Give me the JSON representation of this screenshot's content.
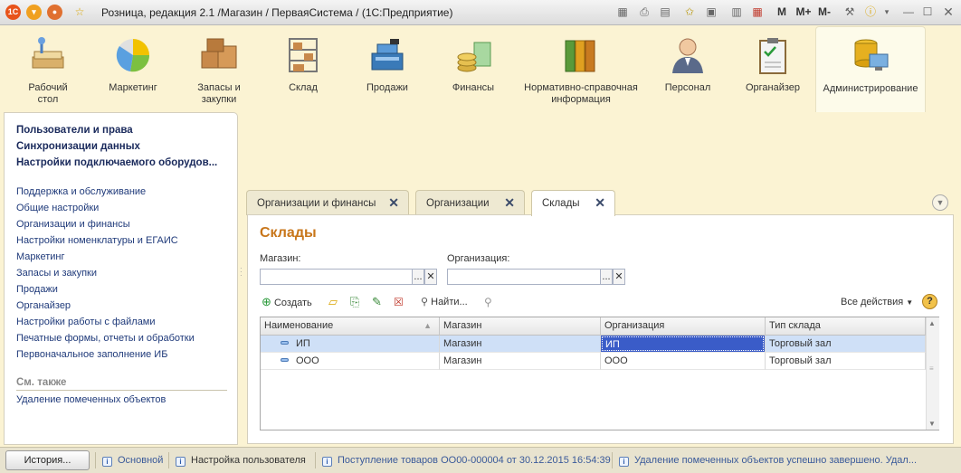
{
  "window": {
    "title": "Розница, редакция 2.1 /Магазин / ПерваяСистема / (1С:Предприятие)",
    "logo": "1С"
  },
  "title_tools": {
    "m": "M",
    "m_plus": "M+",
    "m_minus": "M-"
  },
  "sections": [
    {
      "label": "Рабочий\nстол",
      "icon": "desk-icon"
    },
    {
      "label": "Маркетинг",
      "icon": "pie-chart-icon"
    },
    {
      "label": "Запасы и\nзакупки",
      "icon": "boxes-icon"
    },
    {
      "label": "Склад",
      "icon": "shelves-icon"
    },
    {
      "label": "Продажи",
      "icon": "cash-register-icon"
    },
    {
      "label": "Финансы",
      "icon": "coins-icon"
    },
    {
      "label": "Нормативно-справочная\nинформация",
      "icon": "binders-icon"
    },
    {
      "label": "Персонал",
      "icon": "person-icon"
    },
    {
      "label": "Органайзер",
      "icon": "clipboard-icon"
    },
    {
      "label": "Администрирование",
      "icon": "database-icon",
      "active": true
    }
  ],
  "sidebar": {
    "bold_items": [
      "Пользователи и права",
      "Синхронизации данных",
      "Настройки подключаемого оборудов..."
    ],
    "links": [
      "Поддержка и обслуживание",
      "Общие настройки",
      "Организации и финансы",
      "Настройки номенклатуры и ЕГАИС",
      "Маркетинг",
      "Запасы и закупки",
      "Продажи",
      "Органайзер",
      "Настройки работы с файлами",
      "Печатные формы, отчеты и обработки",
      "Первоначальное заполнение ИБ"
    ],
    "see_also": "См. также",
    "see_also_links": [
      "Удаление помеченных объектов"
    ]
  },
  "tabs": [
    {
      "label": "Организации и финансы"
    },
    {
      "label": "Организации"
    },
    {
      "label": "Склады",
      "active": true
    }
  ],
  "form": {
    "title": "Склады",
    "store_label": "Магазин:",
    "store_value": "",
    "org_label": "Организация:",
    "org_value": "",
    "select_btn": "...",
    "clear_btn": "✕",
    "toolbar": {
      "create": "Создать",
      "find": "Найти...",
      "all_actions": "Все действия",
      "help": "?"
    },
    "table": {
      "columns": [
        "Наименование",
        "Магазин",
        "Организация",
        "Тип склада"
      ],
      "rows": [
        {
          "name": "ИП",
          "store": "Магазин",
          "org": "ИП",
          "type": "Торговый зал",
          "selected": true
        },
        {
          "name": "ООО",
          "store": "Магазин",
          "org": "ООО",
          "type": "Торговый зал",
          "selected": false
        }
      ]
    }
  },
  "statusbar": {
    "history": "История...",
    "items": [
      "Основной",
      "Настройка пользователя",
      "Поступление товаров ОО00-000004 от 30.12.2015 16:54:39",
      "Удаление помеченных объектов успешно завершено. Удал..."
    ]
  },
  "colors": {
    "accent_title": "#c8761a",
    "selection": "#cfe0f7",
    "selected_cell": "#3a5cc8",
    "link": "#1f3a7a",
    "background": "#fbf3d3"
  }
}
